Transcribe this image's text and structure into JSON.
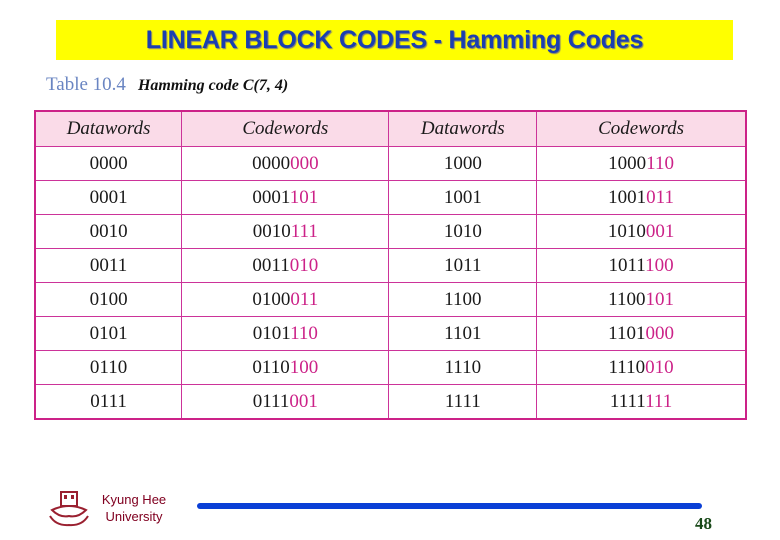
{
  "slide": {
    "title": "LINEAR BLOCK CODES - Hamming Codes",
    "caption_number": "Table 10.4",
    "caption_title": "Hamming code C(7, 4)"
  },
  "table": {
    "headers": [
      "Datawords",
      "Codewords",
      "Datawords",
      "Codewords"
    ],
    "rows": [
      {
        "d1": "0000",
        "c1_data": "0000",
        "c1_parity": "000",
        "d2": "1000",
        "c2_data": "1000",
        "c2_parity": "110"
      },
      {
        "d1": "0001",
        "c1_data": "0001",
        "c1_parity": "101",
        "d2": "1001",
        "c2_data": "1001",
        "c2_parity": "011"
      },
      {
        "d1": "0010",
        "c1_data": "0010",
        "c1_parity": "111",
        "d2": "1010",
        "c2_data": "1010",
        "c2_parity": "001"
      },
      {
        "d1": "0011",
        "c1_data": "0011",
        "c1_parity": "010",
        "d2": "1011",
        "c2_data": "1011",
        "c2_parity": "100"
      },
      {
        "d1": "0100",
        "c1_data": "0100",
        "c1_parity": "011",
        "d2": "1100",
        "c2_data": "1100",
        "c2_parity": "101"
      },
      {
        "d1": "0101",
        "c1_data": "0101",
        "c1_parity": "110",
        "d2": "1101",
        "c2_data": "1101",
        "c2_parity": "000"
      },
      {
        "d1": "0110",
        "c1_data": "0110",
        "c1_parity": "100",
        "d2": "1110",
        "c2_data": "1110",
        "c2_parity": "010"
      },
      {
        "d1": "0111",
        "c1_data": "0111",
        "c1_parity": "001",
        "d2": "1111",
        "c2_data": "1111",
        "c2_parity": "111"
      }
    ]
  },
  "footer": {
    "university_line1": "Kyung Hee",
    "university_line2": "University",
    "logo_icon": "university-emblem-icon",
    "page_number": "48"
  },
  "colors": {
    "title_bg": "#ffff00",
    "title_text": "#1a3fb0",
    "table_border": "#cc2288",
    "header_bg": "#fadbe8",
    "parity_bits": "#cc2288",
    "footer_line": "#0a3fd6"
  }
}
